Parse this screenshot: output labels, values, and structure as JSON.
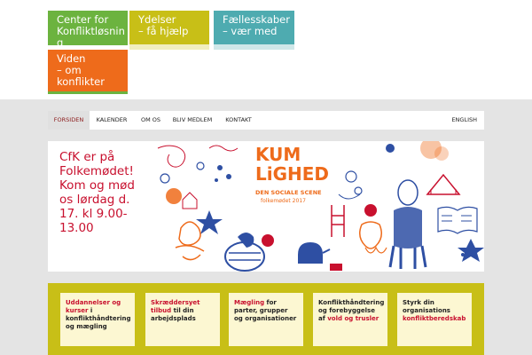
{
  "tiles": [
    {
      "lines": [
        "Center for",
        "Konfliktløsnin",
        "g"
      ],
      "color": "#6cb33f"
    },
    {
      "lines": [
        "Ydelser",
        "– få hjælp"
      ],
      "color": "#c8bf17"
    },
    {
      "lines": [
        "Fællesskaber",
        "– vær med"
      ],
      "color": "#4eabb0"
    },
    {
      "lines": [
        "Viden",
        "– om",
        "konflikter"
      ],
      "color": "#ee6b1b"
    }
  ],
  "nav": {
    "items": [
      "FORSIDEN",
      "KALENDER",
      "OM OS",
      "BLIV MEDLEM",
      "KONTAKT"
    ],
    "language": "ENGLISH"
  },
  "hero": {
    "lines": [
      "CfK er på",
      "Folkemødet!",
      "Kom og mød",
      "os lørdag d.",
      "17. kl 9.00-",
      "13.00"
    ],
    "image": {
      "title_line1": "KUM",
      "title_line2": "LiGHED",
      "subtitle_line1": "DEN SOCIALE SCENE",
      "subtitle_line2": "folkemødet 2017"
    }
  },
  "cards": [
    {
      "highlight": "Uddannelser og kurser",
      "rest": " i konflikthåndtering og mægling"
    },
    {
      "highlight": "Skræddersyet tilbud",
      "rest": " til din arbejdsplads"
    },
    {
      "highlight": "Mægling",
      "rest": " for parter, grupper og organisationer"
    },
    {
      "prefix": "Konflikthåndtering og forebyggelse af ",
      "highlight": "vold og trusler",
      "rest": ""
    },
    {
      "prefix": "Styrk din organisations ",
      "highlight": "konfliktberedskab",
      "rest": ""
    }
  ],
  "colors": {
    "green": "#6cb33f",
    "yellow": "#c8bf17",
    "teal": "#4eabb0",
    "orange": "#ee6b1b",
    "red": "#c8102e",
    "blue": "#2e4fa3"
  }
}
